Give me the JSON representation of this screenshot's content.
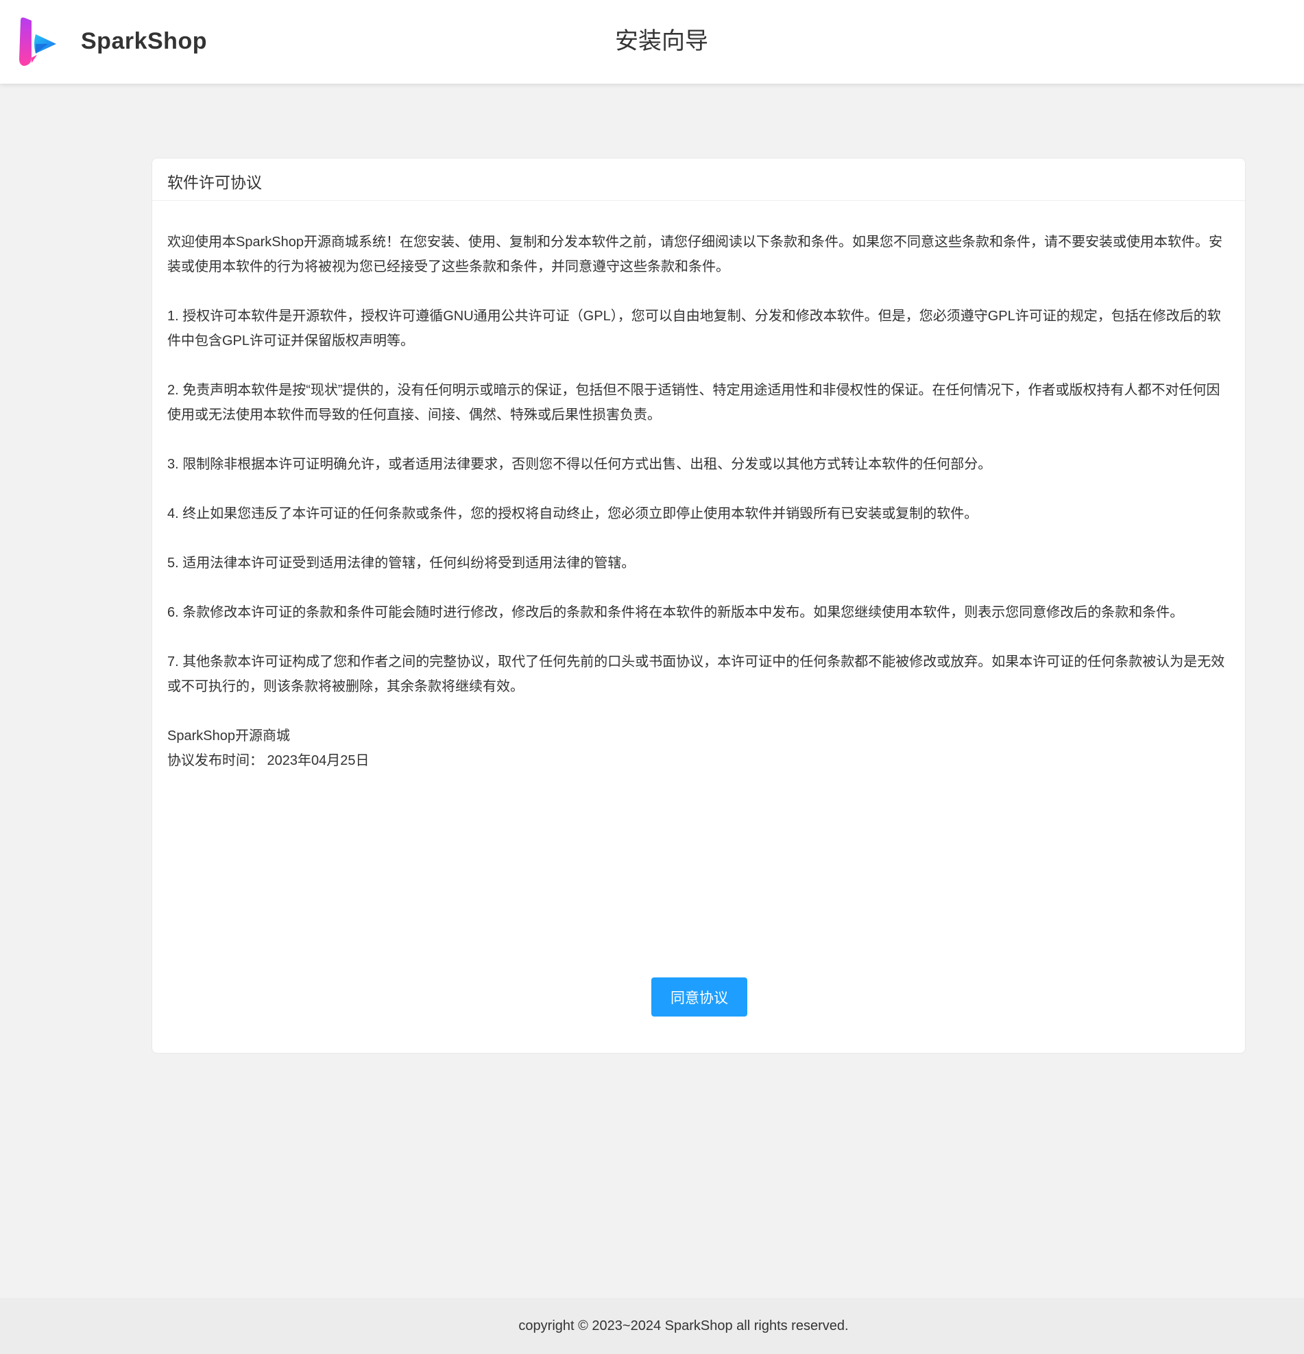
{
  "header": {
    "brand": "SparkShop",
    "title": "安装向导"
  },
  "license": {
    "title": "软件许可协议",
    "paragraphs": [
      "欢迎使用本SparkShop开源商城系统！在您安装、使用、复制和分发本软件之前，请您仔细阅读以下条款和条件。如果您不同意这些条款和条件，请不要安装或使用本软件。安装或使用本软件的行为将被视为您已经接受了这些条款和条件，并同意遵守这些条款和条件。",
      "1. 授权许可本软件是开源软件，授权许可遵循GNU通用公共许可证（GPL），您可以自由地复制、分发和修改本软件。但是，您必须遵守GPL许可证的规定，包括在修改后的软件中包含GPL许可证并保留版权声明等。",
      "2. 免责声明本软件是按“现状”提供的，没有任何明示或暗示的保证，包括但不限于适销性、特定用途适用性和非侵权性的保证。在任何情况下，作者或版权持有人都不对任何因使用或无法使用本软件而导致的任何直接、间接、偶然、特殊或后果性损害负责。",
      "3. 限制除非根据本许可证明确允许，或者适用法律要求，否则您不得以任何方式出售、出租、分发或以其他方式转让本软件的任何部分。",
      "4. 终止如果您违反了本许可证的任何条款或条件，您的授权将自动终止，您必须立即停止使用本软件并销毁所有已安装或复制的软件。",
      "5. 适用法律本许可证受到适用法律的管辖，任何纠纷将受到适用法律的管辖。",
      "6. 条款修改本许可证的条款和条件可能会随时进行修改，修改后的条款和条件将在本软件的新版本中发布。如果您继续使用本软件，则表示您同意修改后的条款和条件。",
      "7. 其他条款本许可证构成了您和作者之间的完整协议，取代了任何先前的口头或书面协议，本许可证中的任何条款都不能被修改或放弃。如果本许可证的任何条款被认为是无效或不可执行的，则该条款将被删除，其余条款将继续有效。"
    ],
    "signature": "SparkShop开源商城",
    "publish_date": "协议发布时间： 2023年04月25日",
    "agree_button": "同意协议"
  },
  "footer": {
    "copyright": "copyright © 2023~2024 SparkShop all rights reserved."
  },
  "colors": {
    "primary_button": "#1e9fff",
    "page_background": "#f2f2f2",
    "logo_pink": "#e53cc8",
    "logo_blue": "#2196f3"
  }
}
